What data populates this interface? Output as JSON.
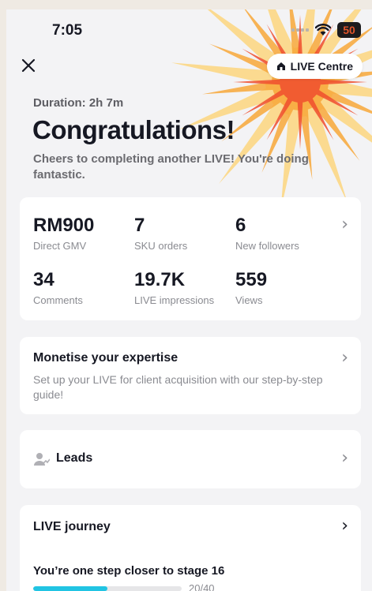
{
  "status": {
    "time": "7:05",
    "battery": "50"
  },
  "header": {
    "live_centre_label": "LIVE Centre"
  },
  "summary": {
    "duration": "Duration: 2h 7m",
    "title": "Congratulations!",
    "subtitle": "Cheers to completing another LIVE! You're doing fantastic."
  },
  "stats": [
    {
      "value": "RM900",
      "label": "Direct GMV"
    },
    {
      "value": "7",
      "label": "SKU orders"
    },
    {
      "value": "6",
      "label": "New followers"
    },
    {
      "value": "34",
      "label": "Comments"
    },
    {
      "value": "19.7K",
      "label": "LIVE impressions"
    },
    {
      "value": "559",
      "label": "Views"
    }
  ],
  "monetise": {
    "title": "Monetise your expertise",
    "desc": "Set up your LIVE for client acquisition with our step-by-step guide!"
  },
  "leads": {
    "label": "Leads"
  },
  "journey": {
    "title": "LIVE journey",
    "step_text": "You’re one step closer to stage 16",
    "progress_text": "20/40",
    "progress_fraction": 0.5
  },
  "colors": {
    "accent": "#21c4e3",
    "burst_red": "#f04e2e",
    "burst_orange": "#f8a83a",
    "burst_yellow": "#fcd886"
  }
}
